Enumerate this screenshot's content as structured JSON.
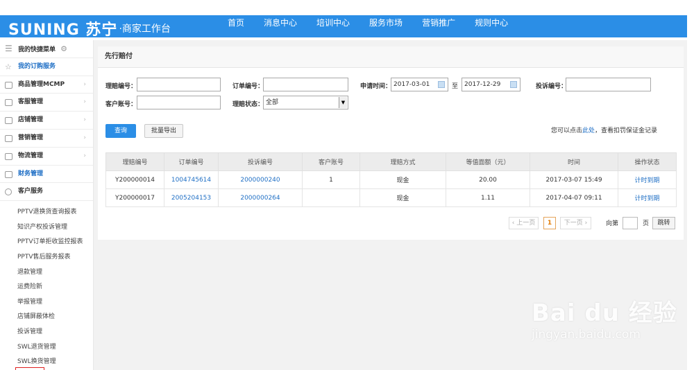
{
  "header": {
    "brand": "SUNING 苏宁",
    "subtitle": "·商家工作台",
    "nav": [
      "首页",
      "消息中心",
      "培训中心",
      "服务市场",
      "营销推广",
      "规则中心"
    ],
    "color": "#2b8ee6"
  },
  "sidebar": {
    "quick_menu": "我的快捷菜单",
    "items": [
      {
        "label": "我的订购服务"
      },
      {
        "label": "商品管理MCMP"
      },
      {
        "label": "客服管理"
      },
      {
        "label": "店铺管理"
      },
      {
        "label": "营销管理"
      },
      {
        "label": "物流管理"
      },
      {
        "label": "财务管理"
      },
      {
        "label": "客户服务"
      }
    ],
    "sub_items": [
      "PPTV退换货查询报表",
      "知识产权投诉管理",
      "PPTV订单拒收监控报表",
      "PPTV售后服务报表",
      "退款管理",
      "运费险新",
      "举报管理",
      "店铺屏蔽体检",
      "投诉管理",
      "SWL退货管理",
      "SWL换货管理"
    ]
  },
  "panel": {
    "title": "先行赔付",
    "filters": {
      "claim_no_label": "理赔编号：",
      "claim_no_value": "",
      "order_no_label": "订单编号：",
      "order_no_value": "",
      "apply_time_label": "申请时间：",
      "date_from": "2017-03-01",
      "date_to_sep": "至",
      "date_to": "2017-12-29",
      "complaint_no_label": "投诉编号：",
      "complaint_no_value": "",
      "customer_label": "客户账号：",
      "customer_value": "",
      "status_label": "理赔状态：",
      "status_value": "全部"
    },
    "buttons": {
      "query": "查询",
      "export": "批量导出"
    },
    "hint_prefix": "您可以点击",
    "hint_link": "此处",
    "hint_suffix": "，查看扣罚保证金记录",
    "table": {
      "headers": [
        "理赔编号",
        "订单编号",
        "投诉编号",
        "客户账号",
        "理赔方式",
        "等值面额（元）",
        "时间",
        "操作状态"
      ],
      "rows": [
        {
          "claim": "Y200000014",
          "order": "1004745614",
          "complaint": "2000000240",
          "customer": "1",
          "method": "现金",
          "amount": "20.00",
          "time": "2017-03-07 15:49",
          "action": "计时到期"
        },
        {
          "claim": "Y200000017",
          "order": "2005204153",
          "complaint": "2000000264",
          "customer": "",
          "method": "现金",
          "amount": "1.11",
          "time": "2017-04-07 09:11",
          "action": "计时到期"
        }
      ]
    },
    "pagination": {
      "prev": "上一页",
      "current": "1",
      "next": "下一页",
      "goto_prefix": "向第",
      "goto_suffix": "页",
      "go": "跳转"
    }
  },
  "watermark": {
    "logo": "Bai du 经验",
    "url": "jingyan.baidu.com"
  }
}
